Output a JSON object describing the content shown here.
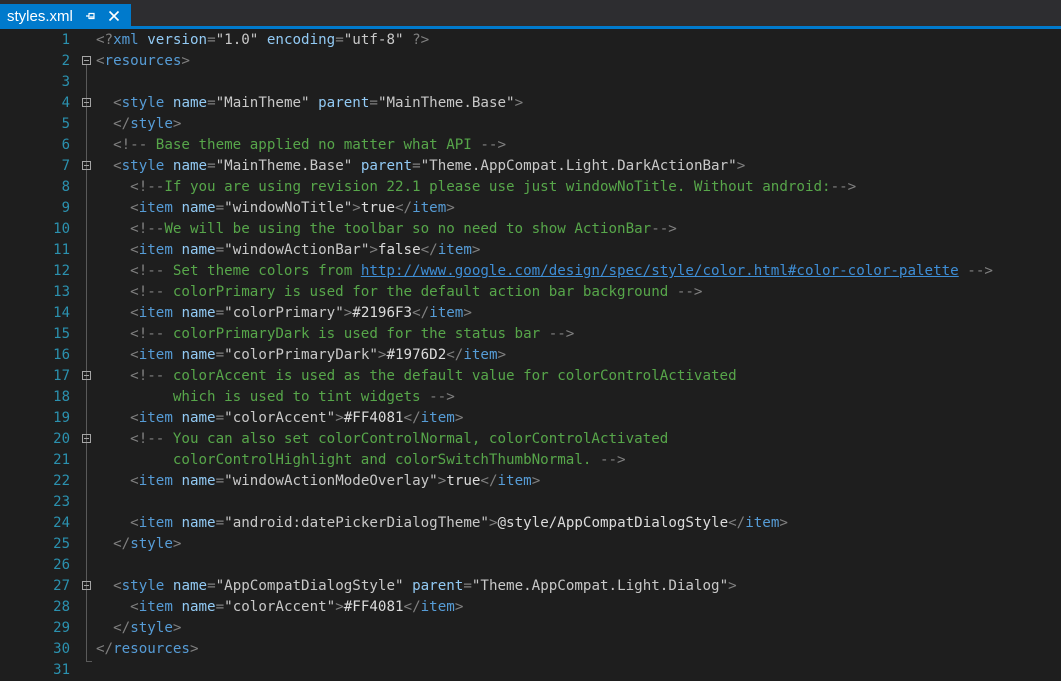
{
  "tab": {
    "file_name": "styles.xml",
    "pin_icon": "pin-icon",
    "close_icon": "close-icon"
  },
  "editor": {
    "lines": [
      {
        "n": "1",
        "tokens": [
          {
            "t": "<?",
            "c": "pun"
          },
          {
            "t": "xml",
            "c": "tag"
          },
          {
            "t": " ",
            "c": "txt"
          },
          {
            "t": "version",
            "c": "att"
          },
          {
            "t": "=",
            "c": "pun"
          },
          {
            "t": "\"1.0\"",
            "c": "val"
          },
          {
            "t": " ",
            "c": "txt"
          },
          {
            "t": "encoding",
            "c": "att"
          },
          {
            "t": "=",
            "c": "pun"
          },
          {
            "t": "\"utf-8\"",
            "c": "val"
          },
          {
            "t": " ?>",
            "c": "pun"
          }
        ]
      },
      {
        "n": "2",
        "fold": true,
        "tokens": [
          {
            "t": "<",
            "c": "pun"
          },
          {
            "t": "resources",
            "c": "tag"
          },
          {
            "t": ">",
            "c": "pun"
          }
        ]
      },
      {
        "n": "3",
        "tokens": []
      },
      {
        "n": "4",
        "fold": true,
        "tokens": [
          {
            "t": "  ",
            "c": "txt"
          },
          {
            "t": "<",
            "c": "pun"
          },
          {
            "t": "style",
            "c": "tag"
          },
          {
            "t": " ",
            "c": "txt"
          },
          {
            "t": "name",
            "c": "att"
          },
          {
            "t": "=",
            "c": "pun"
          },
          {
            "t": "\"MainTheme\"",
            "c": "val"
          },
          {
            "t": " ",
            "c": "txt"
          },
          {
            "t": "parent",
            "c": "att"
          },
          {
            "t": "=",
            "c": "pun"
          },
          {
            "t": "\"MainTheme.Base\"",
            "c": "val"
          },
          {
            "t": ">",
            "c": "pun"
          }
        ]
      },
      {
        "n": "5",
        "tokens": [
          {
            "t": "  ",
            "c": "txt"
          },
          {
            "t": "</",
            "c": "pun"
          },
          {
            "t": "style",
            "c": "tag"
          },
          {
            "t": ">",
            "c": "pun"
          }
        ]
      },
      {
        "n": "6",
        "tokens": [
          {
            "t": "  ",
            "c": "txt"
          },
          {
            "t": "<!--",
            "c": "pun"
          },
          {
            "t": " Base theme applied no matter what API ",
            "c": "com"
          },
          {
            "t": "-->",
            "c": "pun"
          }
        ]
      },
      {
        "n": "7",
        "fold": true,
        "tokens": [
          {
            "t": "  ",
            "c": "txt"
          },
          {
            "t": "<",
            "c": "pun"
          },
          {
            "t": "style",
            "c": "tag"
          },
          {
            "t": " ",
            "c": "txt"
          },
          {
            "t": "name",
            "c": "att"
          },
          {
            "t": "=",
            "c": "pun"
          },
          {
            "t": "\"MainTheme.Base\"",
            "c": "val"
          },
          {
            "t": " ",
            "c": "txt"
          },
          {
            "t": "parent",
            "c": "att"
          },
          {
            "t": "=",
            "c": "pun"
          },
          {
            "t": "\"Theme.AppCompat.Light.DarkActionBar\"",
            "c": "val"
          },
          {
            "t": ">",
            "c": "pun"
          }
        ]
      },
      {
        "n": "8",
        "tokens": [
          {
            "t": "    ",
            "c": "txt"
          },
          {
            "t": "<!--",
            "c": "pun"
          },
          {
            "t": "If you are using revision 22.1 please use just windowNoTitle. Without android:",
            "c": "com"
          },
          {
            "t": "-->",
            "c": "pun"
          }
        ]
      },
      {
        "n": "9",
        "tokens": [
          {
            "t": "    ",
            "c": "txt"
          },
          {
            "t": "<",
            "c": "pun"
          },
          {
            "t": "item",
            "c": "tag"
          },
          {
            "t": " ",
            "c": "txt"
          },
          {
            "t": "name",
            "c": "att"
          },
          {
            "t": "=",
            "c": "pun"
          },
          {
            "t": "\"windowNoTitle\"",
            "c": "val"
          },
          {
            "t": ">",
            "c": "pun"
          },
          {
            "t": "true",
            "c": "txt"
          },
          {
            "t": "</",
            "c": "pun"
          },
          {
            "t": "item",
            "c": "tag"
          },
          {
            "t": ">",
            "c": "pun"
          }
        ]
      },
      {
        "n": "10",
        "tokens": [
          {
            "t": "    ",
            "c": "txt"
          },
          {
            "t": "<!--",
            "c": "pun"
          },
          {
            "t": "We will be using the toolbar so no need to show ActionBar",
            "c": "com"
          },
          {
            "t": "-->",
            "c": "pun"
          }
        ]
      },
      {
        "n": "11",
        "tokens": [
          {
            "t": "    ",
            "c": "txt"
          },
          {
            "t": "<",
            "c": "pun"
          },
          {
            "t": "item",
            "c": "tag"
          },
          {
            "t": " ",
            "c": "txt"
          },
          {
            "t": "name",
            "c": "att"
          },
          {
            "t": "=",
            "c": "pun"
          },
          {
            "t": "\"windowActionBar\"",
            "c": "val"
          },
          {
            "t": ">",
            "c": "pun"
          },
          {
            "t": "false",
            "c": "txt"
          },
          {
            "t": "</",
            "c": "pun"
          },
          {
            "t": "item",
            "c": "tag"
          },
          {
            "t": ">",
            "c": "pun"
          }
        ]
      },
      {
        "n": "12",
        "tokens": [
          {
            "t": "    ",
            "c": "txt"
          },
          {
            "t": "<!--",
            "c": "pun"
          },
          {
            "t": " Set theme colors from ",
            "c": "com"
          },
          {
            "t": "http://www.google.com/design/spec/style/color.html#color-color-palette",
            "c": "lnk"
          },
          {
            "t": " ",
            "c": "com"
          },
          {
            "t": "-->",
            "c": "pun"
          }
        ]
      },
      {
        "n": "13",
        "tokens": [
          {
            "t": "    ",
            "c": "txt"
          },
          {
            "t": "<!--",
            "c": "pun"
          },
          {
            "t": " colorPrimary is used for the default action bar background ",
            "c": "com"
          },
          {
            "t": "-->",
            "c": "pun"
          }
        ]
      },
      {
        "n": "14",
        "tokens": [
          {
            "t": "    ",
            "c": "txt"
          },
          {
            "t": "<",
            "c": "pun"
          },
          {
            "t": "item",
            "c": "tag"
          },
          {
            "t": " ",
            "c": "txt"
          },
          {
            "t": "name",
            "c": "att"
          },
          {
            "t": "=",
            "c": "pun"
          },
          {
            "t": "\"colorPrimary\"",
            "c": "val"
          },
          {
            "t": ">",
            "c": "pun"
          },
          {
            "t": "#2196F3",
            "c": "txt"
          },
          {
            "t": "</",
            "c": "pun"
          },
          {
            "t": "item",
            "c": "tag"
          },
          {
            "t": ">",
            "c": "pun"
          }
        ]
      },
      {
        "n": "15",
        "tokens": [
          {
            "t": "    ",
            "c": "txt"
          },
          {
            "t": "<!--",
            "c": "pun"
          },
          {
            "t": " colorPrimaryDark is used for the status bar ",
            "c": "com"
          },
          {
            "t": "-->",
            "c": "pun"
          }
        ]
      },
      {
        "n": "16",
        "tokens": [
          {
            "t": "    ",
            "c": "txt"
          },
          {
            "t": "<",
            "c": "pun"
          },
          {
            "t": "item",
            "c": "tag"
          },
          {
            "t": " ",
            "c": "txt"
          },
          {
            "t": "name",
            "c": "att"
          },
          {
            "t": "=",
            "c": "pun"
          },
          {
            "t": "\"colorPrimaryDark\"",
            "c": "val"
          },
          {
            "t": ">",
            "c": "pun"
          },
          {
            "t": "#1976D2",
            "c": "txt"
          },
          {
            "t": "</",
            "c": "pun"
          },
          {
            "t": "item",
            "c": "tag"
          },
          {
            "t": ">",
            "c": "pun"
          }
        ]
      },
      {
        "n": "17",
        "fold": true,
        "tokens": [
          {
            "t": "    ",
            "c": "txt"
          },
          {
            "t": "<!--",
            "c": "pun"
          },
          {
            "t": " colorAccent is used as the default value for colorControlActivated",
            "c": "com"
          }
        ]
      },
      {
        "n": "18",
        "tokens": [
          {
            "t": "         which is used to tint widgets ",
            "c": "com"
          },
          {
            "t": "-->",
            "c": "pun"
          }
        ]
      },
      {
        "n": "19",
        "tokens": [
          {
            "t": "    ",
            "c": "txt"
          },
          {
            "t": "<",
            "c": "pun"
          },
          {
            "t": "item",
            "c": "tag"
          },
          {
            "t": " ",
            "c": "txt"
          },
          {
            "t": "name",
            "c": "att"
          },
          {
            "t": "=",
            "c": "pun"
          },
          {
            "t": "\"colorAccent\"",
            "c": "val"
          },
          {
            "t": ">",
            "c": "pun"
          },
          {
            "t": "#FF4081",
            "c": "txt"
          },
          {
            "t": "</",
            "c": "pun"
          },
          {
            "t": "item",
            "c": "tag"
          },
          {
            "t": ">",
            "c": "pun"
          }
        ]
      },
      {
        "n": "20",
        "fold": true,
        "tokens": [
          {
            "t": "    ",
            "c": "txt"
          },
          {
            "t": "<!--",
            "c": "pun"
          },
          {
            "t": " You can also set colorControlNormal, colorControlActivated",
            "c": "com"
          }
        ]
      },
      {
        "n": "21",
        "tokens": [
          {
            "t": "         colorControlHighlight and colorSwitchThumbNormal. ",
            "c": "com"
          },
          {
            "t": "-->",
            "c": "pun"
          }
        ]
      },
      {
        "n": "22",
        "tokens": [
          {
            "t": "    ",
            "c": "txt"
          },
          {
            "t": "<",
            "c": "pun"
          },
          {
            "t": "item",
            "c": "tag"
          },
          {
            "t": " ",
            "c": "txt"
          },
          {
            "t": "name",
            "c": "att"
          },
          {
            "t": "=",
            "c": "pun"
          },
          {
            "t": "\"windowActionModeOverlay\"",
            "c": "val"
          },
          {
            "t": ">",
            "c": "pun"
          },
          {
            "t": "true",
            "c": "txt"
          },
          {
            "t": "</",
            "c": "pun"
          },
          {
            "t": "item",
            "c": "tag"
          },
          {
            "t": ">",
            "c": "pun"
          }
        ]
      },
      {
        "n": "23",
        "tokens": []
      },
      {
        "n": "24",
        "tokens": [
          {
            "t": "    ",
            "c": "txt"
          },
          {
            "t": "<",
            "c": "pun"
          },
          {
            "t": "item",
            "c": "tag"
          },
          {
            "t": " ",
            "c": "txt"
          },
          {
            "t": "name",
            "c": "att"
          },
          {
            "t": "=",
            "c": "pun"
          },
          {
            "t": "\"android:datePickerDialogTheme\"",
            "c": "val"
          },
          {
            "t": ">",
            "c": "pun"
          },
          {
            "t": "@style/AppCompatDialogStyle",
            "c": "txt"
          },
          {
            "t": "</",
            "c": "pun"
          },
          {
            "t": "item",
            "c": "tag"
          },
          {
            "t": ">",
            "c": "pun"
          }
        ]
      },
      {
        "n": "25",
        "tokens": [
          {
            "t": "  ",
            "c": "txt"
          },
          {
            "t": "</",
            "c": "pun"
          },
          {
            "t": "style",
            "c": "tag"
          },
          {
            "t": ">",
            "c": "pun"
          }
        ]
      },
      {
        "n": "26",
        "tokens": []
      },
      {
        "n": "27",
        "fold": true,
        "tokens": [
          {
            "t": "  ",
            "c": "txt"
          },
          {
            "t": "<",
            "c": "pun"
          },
          {
            "t": "style",
            "c": "tag"
          },
          {
            "t": " ",
            "c": "txt"
          },
          {
            "t": "name",
            "c": "att"
          },
          {
            "t": "=",
            "c": "pun"
          },
          {
            "t": "\"AppCompatDialogStyle\"",
            "c": "val"
          },
          {
            "t": " ",
            "c": "txt"
          },
          {
            "t": "parent",
            "c": "att"
          },
          {
            "t": "=",
            "c": "pun"
          },
          {
            "t": "\"Theme.AppCompat.Light.Dialog\"",
            "c": "val"
          },
          {
            "t": ">",
            "c": "pun"
          }
        ]
      },
      {
        "n": "28",
        "tokens": [
          {
            "t": "    ",
            "c": "txt"
          },
          {
            "t": "<",
            "c": "pun"
          },
          {
            "t": "item",
            "c": "tag"
          },
          {
            "t": " ",
            "c": "txt"
          },
          {
            "t": "name",
            "c": "att"
          },
          {
            "t": "=",
            "c": "pun"
          },
          {
            "t": "\"colorAccent\"",
            "c": "val"
          },
          {
            "t": ">",
            "c": "pun"
          },
          {
            "t": "#FF4081",
            "c": "txt"
          },
          {
            "t": "</",
            "c": "pun"
          },
          {
            "t": "item",
            "c": "tag"
          },
          {
            "t": ">",
            "c": "pun"
          }
        ]
      },
      {
        "n": "29",
        "tokens": [
          {
            "t": "  ",
            "c": "txt"
          },
          {
            "t": "</",
            "c": "pun"
          },
          {
            "t": "style",
            "c": "tag"
          },
          {
            "t": ">",
            "c": "pun"
          }
        ]
      },
      {
        "n": "30",
        "tokens": [
          {
            "t": "</",
            "c": "pun"
          },
          {
            "t": "resources",
            "c": "tag"
          },
          {
            "t": ">",
            "c": "pun"
          }
        ]
      },
      {
        "n": "31",
        "tokens": []
      }
    ]
  }
}
